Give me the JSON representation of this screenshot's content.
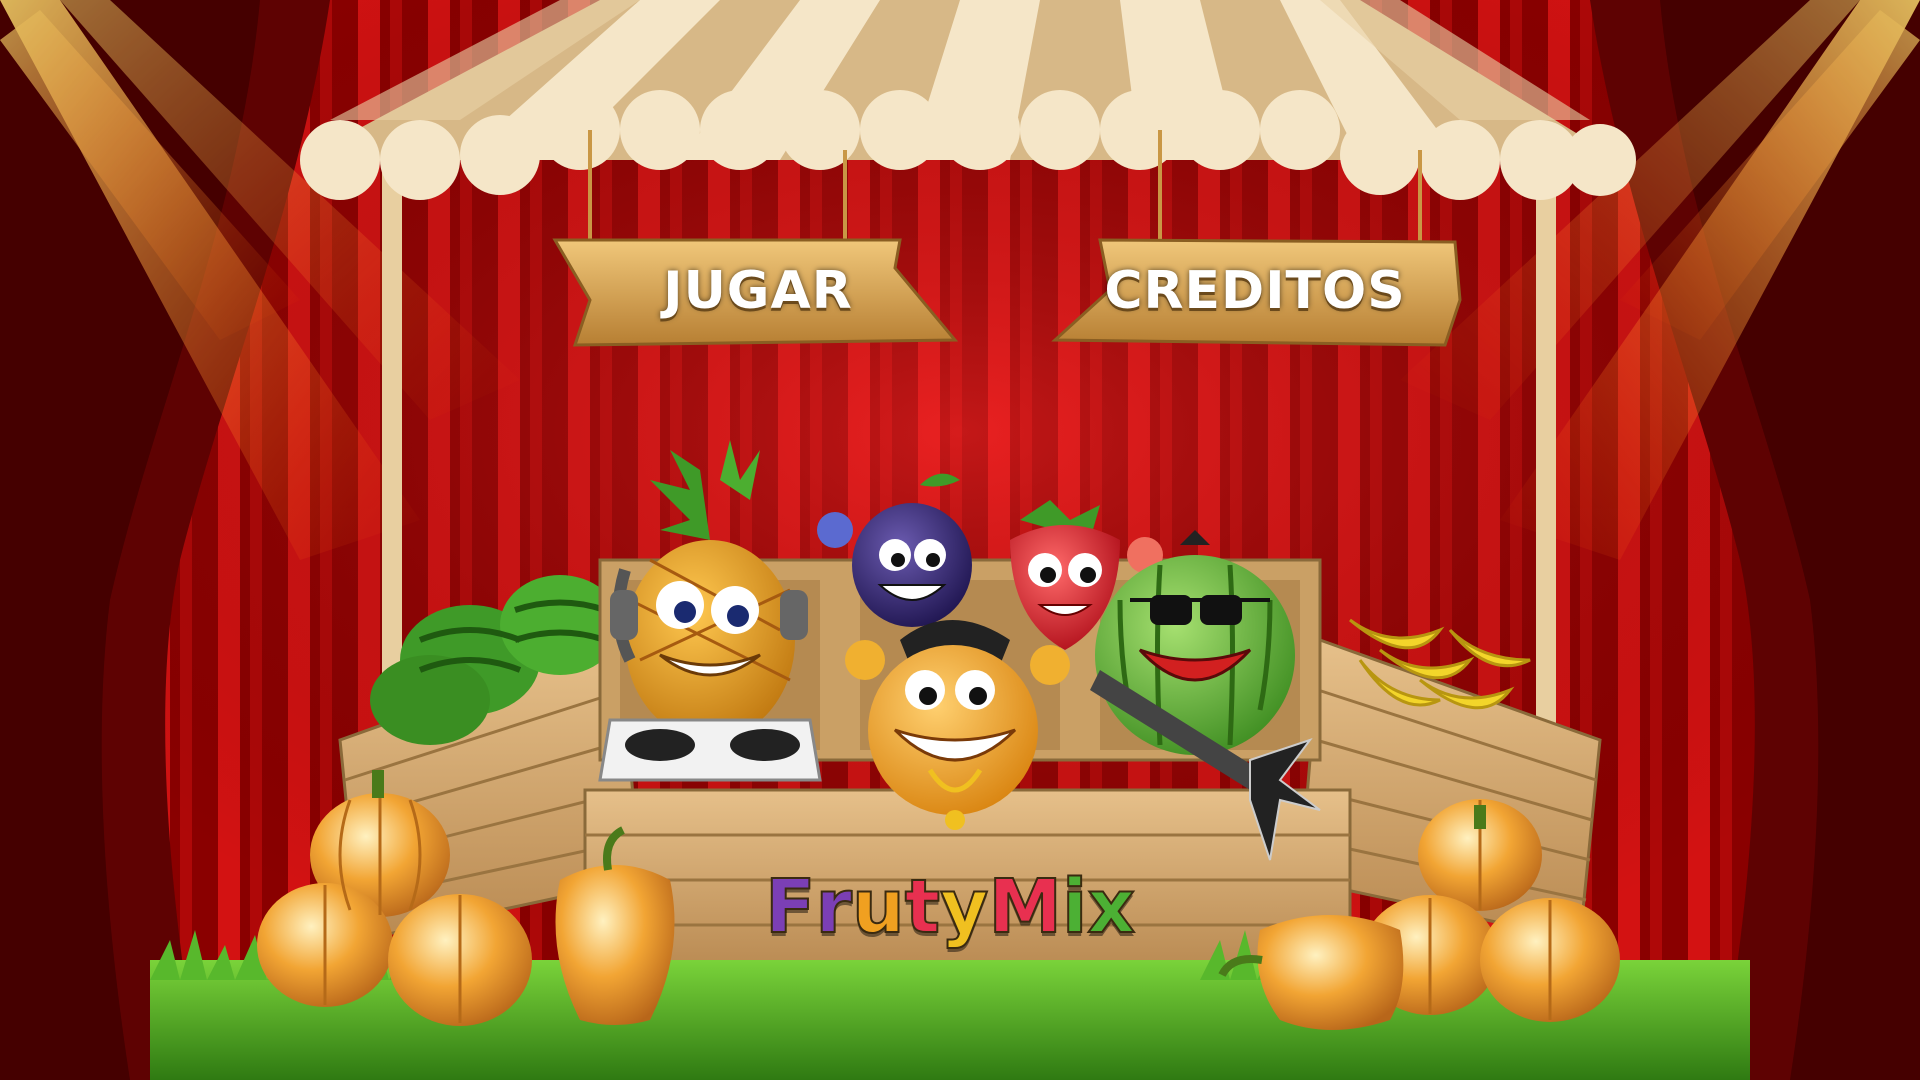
{
  "menu": {
    "play_label": "JUGAR",
    "credits_label": "CREDITOS"
  },
  "logo": {
    "text": "FrutyMix",
    "letters": [
      {
        "char": "F",
        "color": "#7b3fb5"
      },
      {
        "char": "r",
        "color": "#7b3fb5"
      },
      {
        "char": "u",
        "color": "#f0a020"
      },
      {
        "char": "t",
        "color": "#e83050"
      },
      {
        "char": "y",
        "color": "#f0c020"
      },
      {
        "char": "M",
        "color": "#e83050"
      },
      {
        "char": "i",
        "color": "#4cb034"
      },
      {
        "char": "x",
        "color": "#4cb034"
      }
    ]
  },
  "colors": {
    "curtain": "#b80a0a",
    "wood": "#d2a86c",
    "awning_cream": "#f5e6c8",
    "awning_tan": "#d7b887",
    "grass": "#4caf26",
    "sign_wood": "#d9a75b"
  },
  "characters": [
    {
      "name": "pineapple-dj",
      "icon": "pineapple-icon"
    },
    {
      "name": "plum",
      "icon": "plum-icon"
    },
    {
      "name": "strawberry",
      "icon": "strawberry-icon"
    },
    {
      "name": "orange-rapper",
      "icon": "orange-icon"
    },
    {
      "name": "watermelon-guitarist",
      "icon": "watermelon-icon"
    }
  ]
}
